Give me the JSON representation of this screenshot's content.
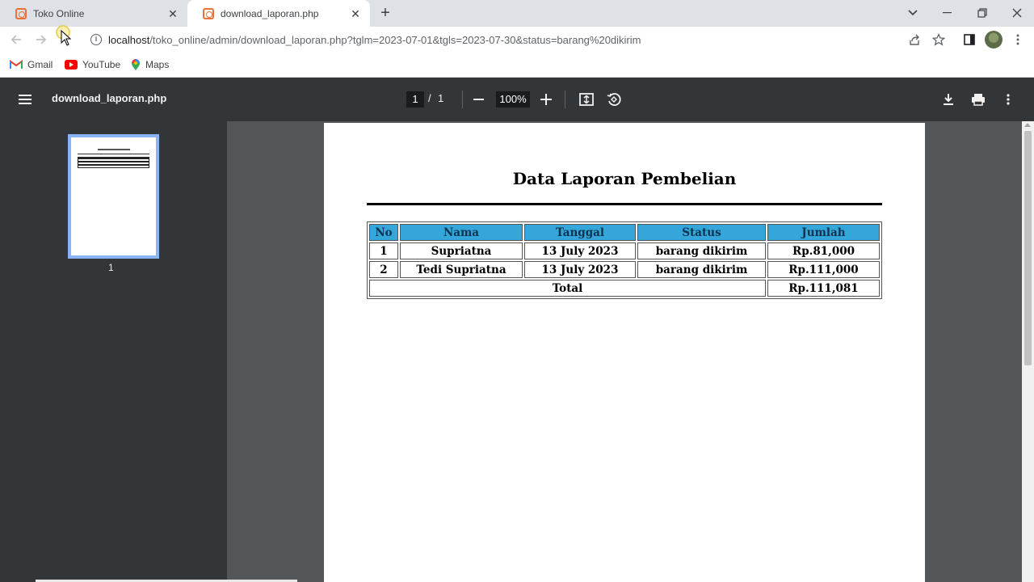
{
  "browser": {
    "tabs": [
      {
        "title": "Toko Online",
        "active": false
      },
      {
        "title": "download_laporan.php",
        "active": true
      }
    ],
    "close_glyph": "✕",
    "new_tab_glyph": "+",
    "url_host": "localhost",
    "url_path": "/toko_online/admin/download_laporan.php?tglm=2023-07-01&tgls=2023-07-30&status=barang%20dikirim",
    "info_glyph": "i",
    "bookmarks": [
      {
        "label": "Gmail",
        "icon": "gmail-icon"
      },
      {
        "label": "YouTube",
        "icon": "youtube-icon"
      },
      {
        "label": "Maps",
        "icon": "maps-icon"
      }
    ],
    "colors": {
      "accent": "#e8713c",
      "tabstrip": "#dee1e6"
    }
  },
  "pdf_viewer": {
    "file_name": "download_laporan.php",
    "current_page": "1",
    "page_separator": "/",
    "total_pages": "1",
    "zoom": "100%",
    "thumbnail_label": "1",
    "colors": {
      "toolbar": "#323639",
      "canvas": "#525659",
      "thumb_border": "#8ab4f8"
    }
  },
  "document": {
    "title": "Data Laporan Pembelian",
    "table": {
      "headers": [
        "No",
        "Nama",
        "Tanggal",
        "Status",
        "Jumlah"
      ],
      "rows": [
        {
          "no": "1",
          "nama": "Supriatna",
          "tanggal": "13 July 2023",
          "status": "barang dikirim",
          "jumlah": "Rp.81,000"
        },
        {
          "no": "2",
          "nama": "Tedi Supriatna",
          "tanggal": "13 July 2023",
          "status": "barang dikirim",
          "jumlah": "Rp.111,000"
        }
      ],
      "total_label": "Total",
      "total_value": "Rp.111,081",
      "header_color": "#35a6d9"
    }
  }
}
